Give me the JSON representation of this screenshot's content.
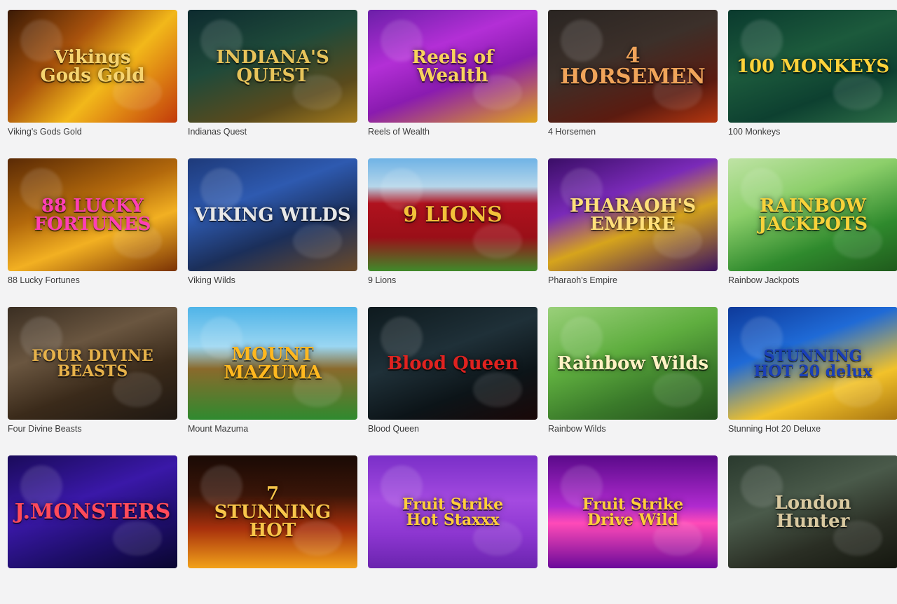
{
  "games": [
    {
      "title": "Viking's Gods Gold",
      "logo": "Vikings\nGods Gold",
      "bg": "linear-gradient(135deg,#3a1a05 0%,#a8520c 35%,#f2b81a 60%,#c23a0a 100%)",
      "logo_color": "#f6d470"
    },
    {
      "title": "Indianas Quest",
      "logo": "INDIANA'S\nQUEST",
      "bg": "linear-gradient(160deg,#0d2b2f 0%,#1f4a3a 40%,#5a4a1c 75%,#a37a1c 100%)",
      "logo_color": "#e7c35a"
    },
    {
      "title": "Reels of Wealth",
      "logo": "Reels of\nWealth",
      "bg": "linear-gradient(160deg,#6b1fa8 0%,#b32fd6 35%,#8a1bb0 60%,#e0a31a 100%)",
      "logo_color": "#f8d35c"
    },
    {
      "title": "4 Horsemen",
      "logo": "4\nHORSEMEN",
      "bg": "linear-gradient(160deg,#2a2522 0%,#3c302a 40%,#5b1b10 75%,#b5360f 100%)",
      "logo_color": "#f0a45a"
    },
    {
      "title": "100 Monkeys",
      "logo": "100 MONKEYS",
      "bg": "linear-gradient(160deg,#0a3a2e 0%,#1c5a3c 40%,#0d4030 70%,#2d6d47 100%)",
      "logo_color": "#ffd23a"
    },
    {
      "title": "88 Lucky Fortunes",
      "logo": "88 LUCKY\nFORTUNES",
      "bg": "linear-gradient(160deg,#5a2a05 0%,#b3690c 40%,#f2b022 65%,#7a3205 100%)",
      "logo_color": "#ff3fb4"
    },
    {
      "title": "Viking Wilds",
      "logo": "VIKING WILDS",
      "bg": "linear-gradient(160deg,#1e3a7a 0%,#2e5ab0 35%,#1b2f5a 65%,#6a4a2a 100%)",
      "logo_color": "#e8e8e8"
    },
    {
      "title": "9 Lions",
      "logo": "9 LIONS",
      "bg": "linear-gradient(180deg,#6fb3e6 0%,#b5d6ea 25%,#b0121e 40%,#9a0f18 70%,#3f8a2a 100%)",
      "logo_color": "#f3c13a"
    },
    {
      "title": "Pharaoh's Empire",
      "logo": "PHARAOH'S EMPIRE",
      "bg": "linear-gradient(160deg,#3a0e66 0%,#7a2ab8 35%,#d6a41c 60%,#3b1260 100%)",
      "logo_color": "#ffe07a"
    },
    {
      "title": "Rainbow Jackpots",
      "logo": "RAINBOW\nJACKPOTS",
      "bg": "linear-gradient(160deg,#bfe3a5 0%,#8ccf6a 35%,#2f8a2d 70%,#1f5a1c 100%)",
      "logo_color": "#f8d23a"
    },
    {
      "title": "Four Divine Beasts",
      "logo": "FOUR DIVINE\nBEASTS",
      "bg": "linear-gradient(160deg,#3a2e22 0%,#6a5640 35%,#3a2a1a 65%,#1f1812 100%)",
      "logo_color": "#e7b24a"
    },
    {
      "title": "Mount Mazuma",
      "logo": "MOUNT\nMAZUMA",
      "bg": "linear-gradient(180deg,#4fb4e8 0%,#9ad6f2 35%,#8a6a2c 55%,#2f8a2f 100%)",
      "logo_color": "#ffb81f"
    },
    {
      "title": "Blood Queen",
      "logo": "Blood Queen",
      "bg": "linear-gradient(160deg,#0e1a1e 0%,#1f3038 40%,#0c1418 70%,#1a0808 100%)",
      "logo_color": "#e0221f"
    },
    {
      "title": "Rainbow Wilds",
      "logo": "Rainbow Wilds",
      "bg": "linear-gradient(160deg,#9ad07a 0%,#5fae3f 40%,#3a7a2a 70%,#24501c 100%)",
      "logo_color": "#fff2c4"
    },
    {
      "title": "Stunning Hot 20 Deluxe",
      "logo": "STUNNING\nHOT 20 delux",
      "bg": "linear-gradient(160deg,#0e3a9a 0%,#1f6ad6 35%,#f2c22a 70%,#a87410 100%)",
      "logo_color": "#1a3fb8"
    },
    {
      "title": "",
      "logo": "J.MONSTERS",
      "bg": "linear-gradient(160deg,#1a0b5a 0%,#3a18a8 40%,#1e0e6a 70%,#0a0630 100%)",
      "logo_color": "#ff4a5a"
    },
    {
      "title": "",
      "logo": "7\nSTUNNING HOT",
      "bg": "linear-gradient(180deg,#1a0a05 0%,#3a1508 35%,#a8300c 65%,#f2a21a 100%)",
      "logo_color": "#f8c64a"
    },
    {
      "title": "",
      "logo": "Fruit Strike\nHot Staxxx",
      "bg": "linear-gradient(180deg,#7a2fc8 0%,#a44ae0 40%,#8c36d0 70%,#6a24ae 100%)",
      "logo_color": "#ffce3a"
    },
    {
      "title": "",
      "logo": "Fruit Strike\nDrive Wild",
      "bg": "linear-gradient(180deg,#5a0a8a 0%,#b02acf 45%,#ff4ab8 60%,#6a0a9a 100%)",
      "logo_color": "#ffce3a"
    },
    {
      "title": "",
      "logo": "London\nHunter",
      "bg": "linear-gradient(160deg,#2a3a2e 0%,#4a5a4a 40%,#2a2e24 70%,#15170f 100%)",
      "logo_color": "#d9c9a0"
    }
  ]
}
